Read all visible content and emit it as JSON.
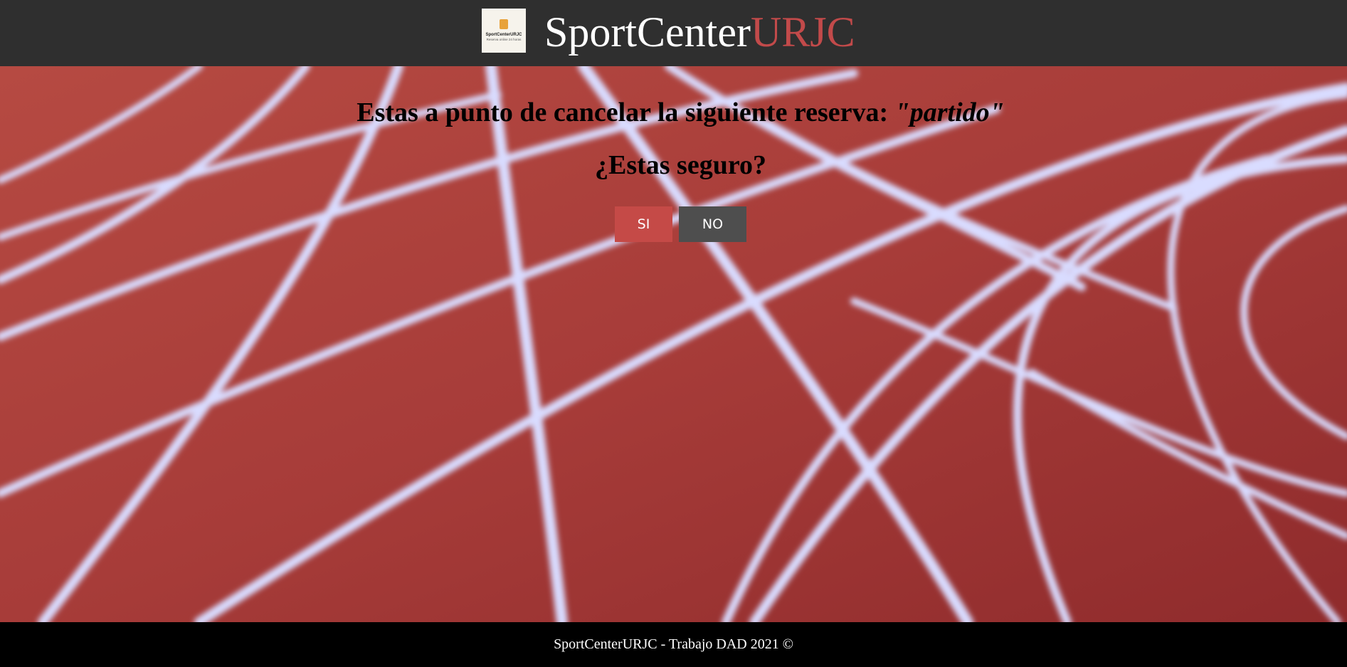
{
  "header": {
    "brand_primary": "SportCenter",
    "brand_accent": "URJC",
    "logo": {
      "name": "SportCenterURJC",
      "tagline": "Reserva online 24 horas"
    }
  },
  "confirm": {
    "message_prefix": "Estas a punto de cancelar la siguiente reserva:",
    "reservation_name": "\"partido\"",
    "question": "¿Estas seguro?",
    "yes_label": "SI",
    "no_label": "NO"
  },
  "footer": {
    "text": "SportCenterURJC - Trabajo DAD 2021 ©"
  },
  "colors": {
    "header_bg": "#2f2f2f",
    "accent": "#c24a4a",
    "yes_button": "#c54a47",
    "no_button": "#4e4e4e",
    "footer_bg": "#000000"
  }
}
